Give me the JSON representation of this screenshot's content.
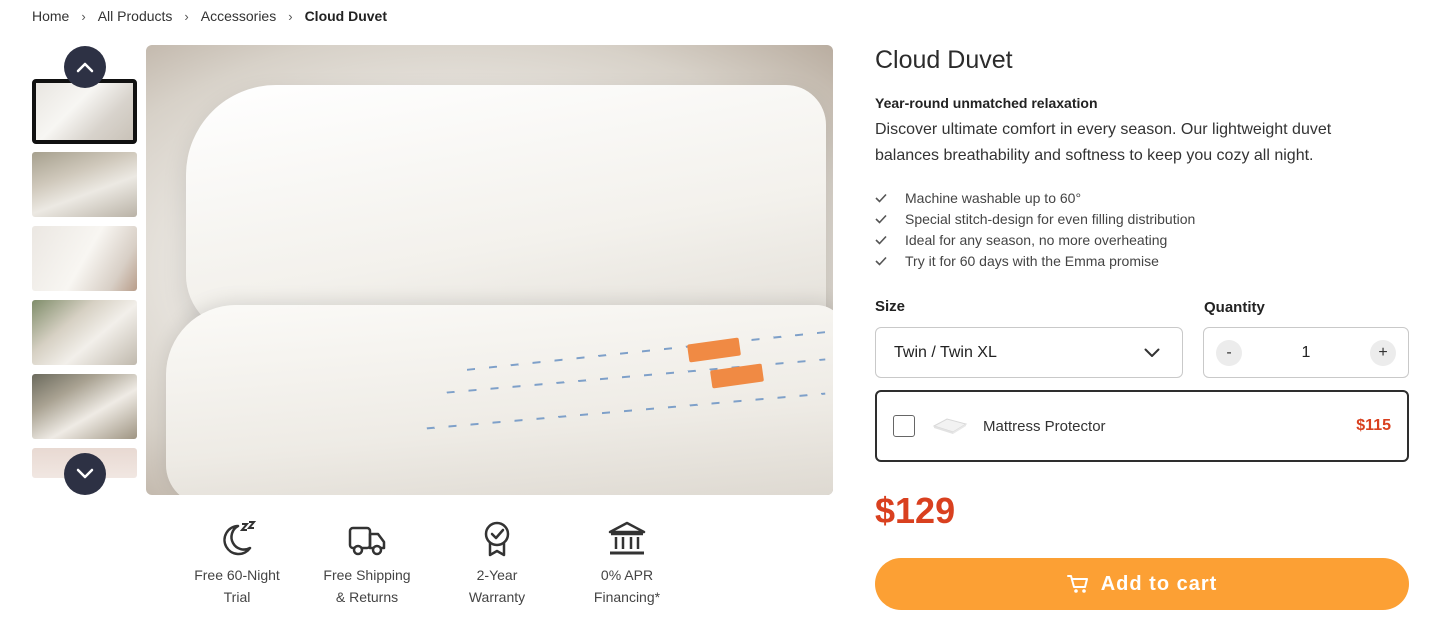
{
  "breadcrumb": {
    "items": [
      "Home",
      "All Products",
      "Accessories"
    ],
    "current": "Cloud Duvet"
  },
  "gallery": {
    "thumbnail_count": 6,
    "active_index": 0,
    "nav_up_icon": "chevron-up-icon",
    "nav_down_icon": "chevron-down-icon"
  },
  "features": [
    {
      "icon": "moon-sleep-icon",
      "line1": "Free 60-Night",
      "line2": "Trial"
    },
    {
      "icon": "truck-icon",
      "line1": "Free Shipping",
      "line2": "& Returns"
    },
    {
      "icon": "award-badge-icon",
      "line1": "2-Year",
      "line2": "Warranty"
    },
    {
      "icon": "bank-icon",
      "line1": "0% APR",
      "line2": "Financing*"
    }
  ],
  "product": {
    "title": "Cloud Duvet",
    "subtitle": "Year-round unmatched relaxation",
    "description_line1": "Discover ultimate comfort in every season. Our lightweight duvet",
    "description_line2": "balances breathability and softness to keep you cozy all night.",
    "bullets": [
      "Machine washable up to 60°",
      "Special stitch-design for even filling distribution",
      "Ideal for any season, no more overheating",
      "Try it for 60 days with the Emma promise"
    ],
    "price": "$129"
  },
  "options": {
    "size_label": "Size",
    "size_value": "Twin / Twin XL",
    "quantity_label": "Quantity",
    "quantity_value": "1",
    "minus": "-",
    "plus": "+"
  },
  "addon": {
    "name": "Mattress Protector",
    "price": "$115",
    "checked": false
  },
  "cta": {
    "label": "Add to cart"
  },
  "colors": {
    "accent": "#fca034",
    "price": "#d9401f",
    "nav_button": "#2d3144"
  }
}
